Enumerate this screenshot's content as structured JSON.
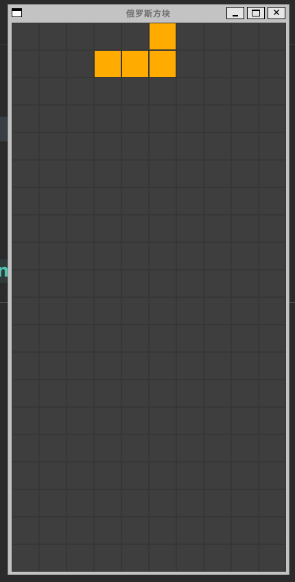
{
  "window": {
    "title": "俄罗斯方块",
    "close_glyph": "✕"
  },
  "background": {
    "left_letter": "n"
  },
  "board": {
    "columns": 10,
    "rows": 20,
    "grid_color": "#353535",
    "cell_background": "#3e3e3e",
    "piece": {
      "type": "L",
      "color": "#ffab00",
      "cells": [
        {
          "col": 5,
          "row": 0
        },
        {
          "col": 3,
          "row": 1
        },
        {
          "col": 4,
          "row": 1
        },
        {
          "col": 5,
          "row": 1
        }
      ]
    }
  },
  "icons": {
    "system_menu": "window-icon",
    "minimize": "minimize-icon",
    "maximize": "maximize-icon",
    "close": "close-icon"
  }
}
